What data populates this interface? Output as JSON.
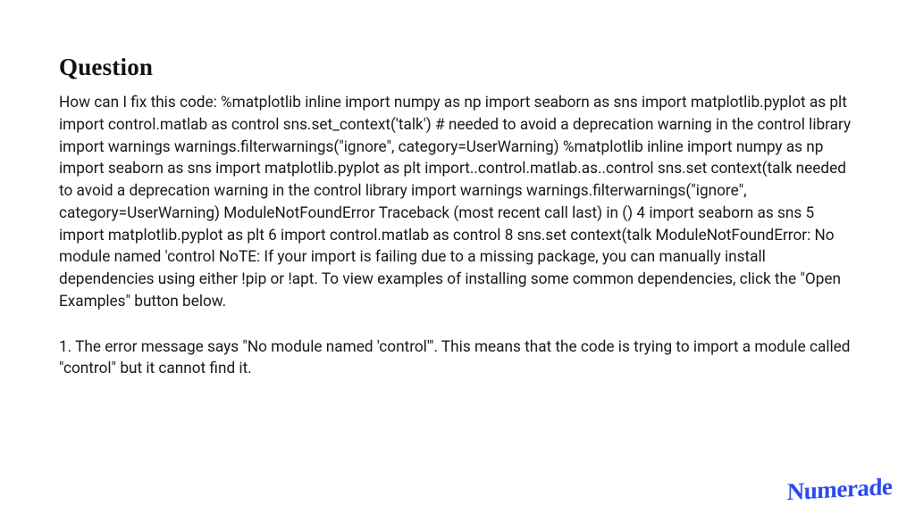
{
  "heading": "Question",
  "question_body": "How can I fix this code: %matplotlib inline import numpy as np import seaborn as sns import matplotlib.pyplot as plt import control.matlab as control sns.set_context('talk') # needed to avoid a deprecation warning in the control library import warnings warnings.filterwarnings(\"ignore\", category=UserWarning) %matplotlib inline import numpy as np import seaborn as sns import matplotlib.pyplot as plt import..control.matlab.as..control sns.set context(talk needed to avoid a deprecation warning in the control library import warnings warnings.filterwarnings(\"ignore\", category=UserWarning) ModuleNotFoundError Traceback (most recent call last) in () 4 import seaborn as sns 5 import matplotlib.pyplot as plt 6 import control.matlab as control 8 sns.set context(talk ModuleNotFoundError: No module named 'control NoTE: If your import is failing due to a missing package, you can manually install dependencies using either !pip or !apt. To view examples of installing some common dependencies, click the \"Open Examples\" button below.",
  "answer_text": "1. The error message says \"No module named 'control'\". This means that the code is trying to import a module called \"control\" but it cannot find it.",
  "brand": "Numerade"
}
